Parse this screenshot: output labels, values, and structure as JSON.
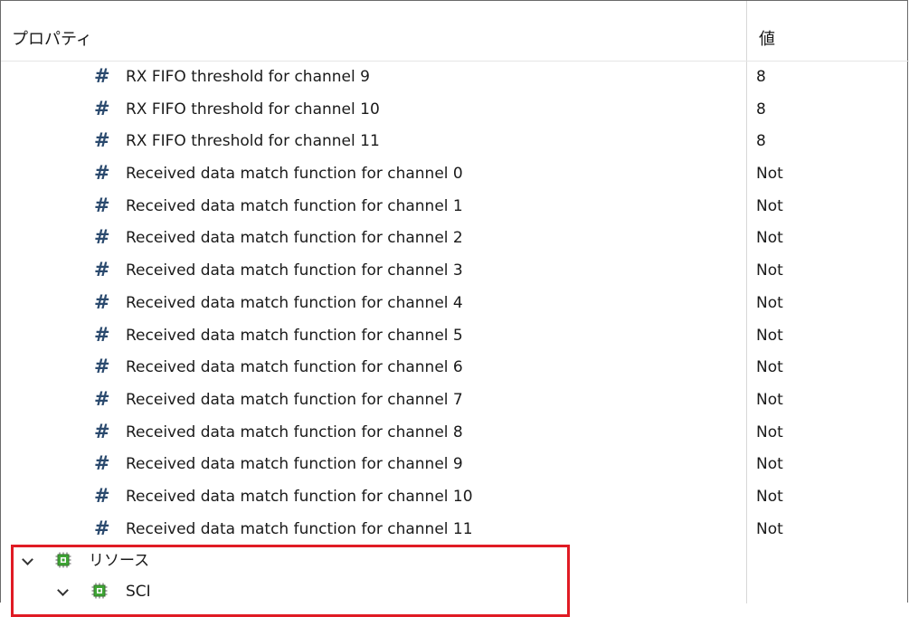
{
  "header": {
    "property_label": "プロパティ",
    "value_label": "値"
  },
  "rows": [
    {
      "icon": "hash-icon",
      "name": "RX FIFO threshold for channel 9",
      "value": "8"
    },
    {
      "icon": "hash-icon",
      "name": "RX FIFO threshold for channel 10",
      "value": "8"
    },
    {
      "icon": "hash-icon",
      "name": "RX FIFO threshold for channel 11",
      "value": "8"
    },
    {
      "icon": "hash-icon",
      "name": "Received data match function for channel 0",
      "value": "Not"
    },
    {
      "icon": "hash-icon",
      "name": "Received data match function for channel 1",
      "value": "Not"
    },
    {
      "icon": "hash-icon",
      "name": "Received data match function for channel 2",
      "value": "Not"
    },
    {
      "icon": "hash-icon",
      "name": "Received data match function for channel 3",
      "value": "Not"
    },
    {
      "icon": "hash-icon",
      "name": "Received data match function for channel 4",
      "value": "Not"
    },
    {
      "icon": "hash-icon",
      "name": "Received data match function for channel 5",
      "value": "Not"
    },
    {
      "icon": "hash-icon",
      "name": "Received data match function for channel 6",
      "value": "Not"
    },
    {
      "icon": "hash-icon",
      "name": "Received data match function for channel 7",
      "value": "Not"
    },
    {
      "icon": "hash-icon",
      "name": "Received data match function for channel 8",
      "value": "Not"
    },
    {
      "icon": "hash-icon",
      "name": "Received data match function for channel 9",
      "value": "Not"
    },
    {
      "icon": "hash-icon",
      "name": "Received data match function for channel 10",
      "value": "Not"
    },
    {
      "icon": "hash-icon",
      "name": "Received data match function for channel 11",
      "value": "Not"
    }
  ],
  "tree": {
    "resources": {
      "label": "リソース",
      "icon": "chip-icon",
      "expanded": true
    },
    "sci": {
      "label": "SCI",
      "icon": "chip-icon",
      "expanded": true
    }
  },
  "hash_glyph": "#",
  "colors": {
    "hash_icon": "#2b4a6e",
    "chip_icon": "#3fa535",
    "highlight": "#e01b24"
  }
}
